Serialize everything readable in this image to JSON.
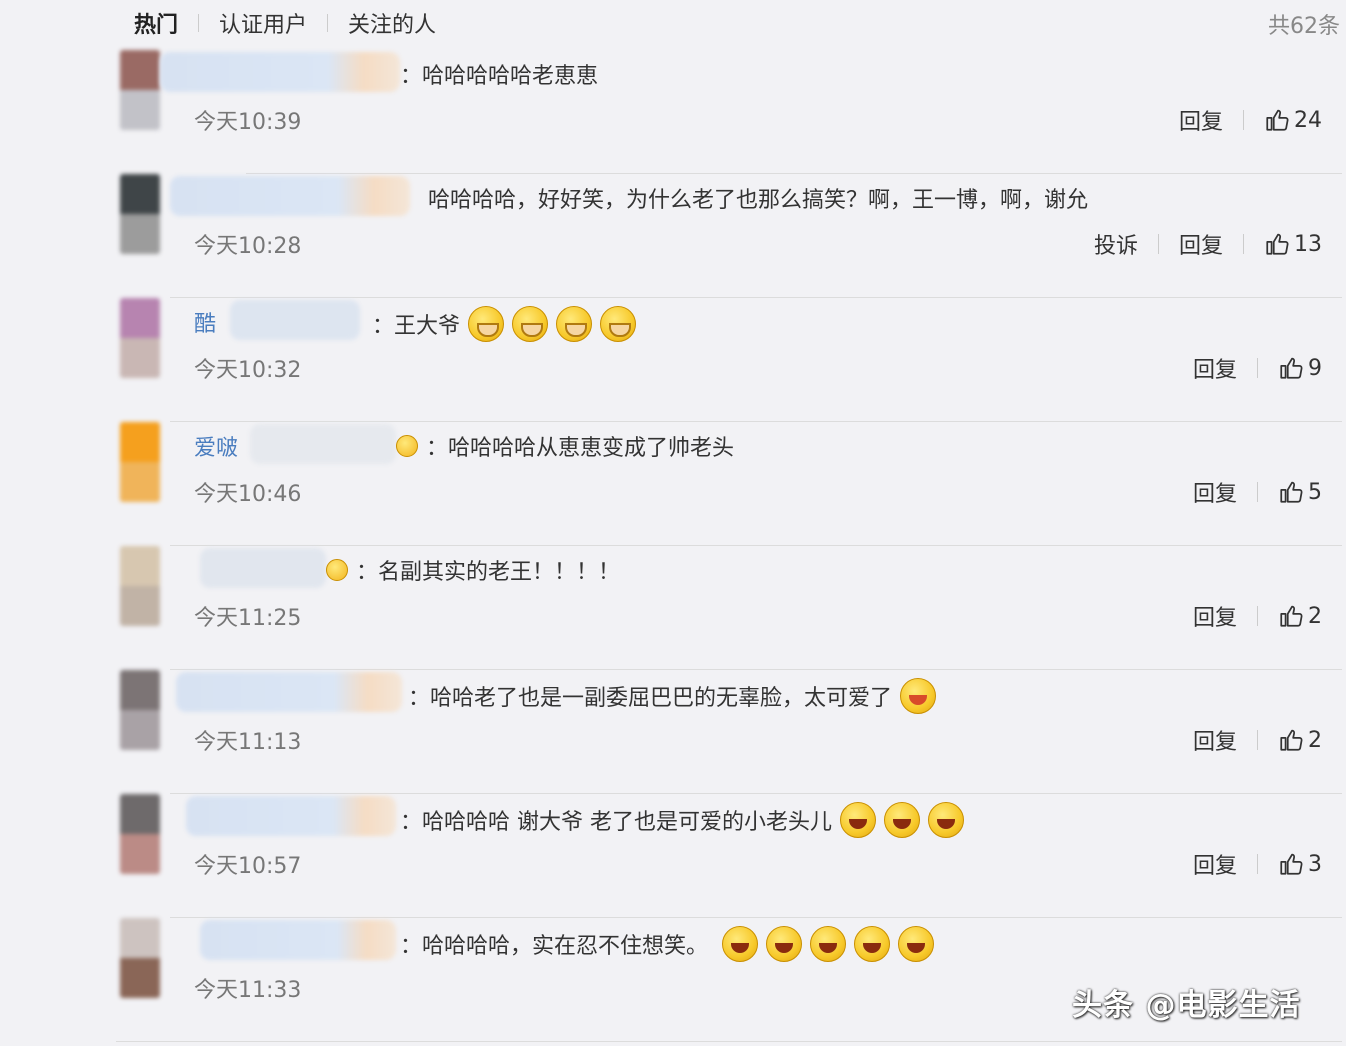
{
  "tabs": [
    "热门",
    "认证用户",
    "关注的人"
  ],
  "total": "共62条",
  "reply_label": "回复",
  "report_label": "投诉",
  "comments": [
    {
      "name": "",
      "content": "：哈哈哈哈哈老恵恵",
      "time": "今天10:39",
      "likes": "24",
      "has_report": false,
      "avatar_colors": [
        "#9a6a64",
        "#c2c2c8"
      ]
    },
    {
      "name": "",
      "content": "哈哈哈哈，好好笑，为什么老了也那么搞笑？啊，王一博，啊，谢允",
      "time": "今天10:28",
      "likes": "13",
      "has_report": true,
      "avatar_colors": [
        "#3f4548",
        "#9c9c9c"
      ]
    },
    {
      "name": "酷",
      "content": "：王大爷",
      "time": "今天10:32",
      "likes": "9",
      "has_report": false,
      "avatar_colors": [
        "#b784b0",
        "#c9b7b4"
      ]
    },
    {
      "name": "爱啵",
      "content": "：哈哈哈哈从恵恵变成了帅老头",
      "time": "今天10:46",
      "likes": "5",
      "has_report": false,
      "avatar_colors": [
        "#f5a01e",
        "#f0b45a"
      ]
    },
    {
      "name": "",
      "content": "：名副其实的老王！！！！",
      "time": "今天11:25",
      "likes": "2",
      "has_report": false,
      "avatar_colors": [
        "#d7c7b0",
        "#c1b3a6"
      ]
    },
    {
      "name": "",
      "content": "：哈哈老了也是一副委屈巴巴的无辜脸，太可爱了",
      "time": "今天11:13",
      "likes": "2",
      "has_report": false,
      "avatar_colors": [
        "#7c7475",
        "#a9a2a6"
      ]
    },
    {
      "name": "",
      "content": "：哈哈哈哈 谢大爷 老了也是可爱的小老头儿",
      "time": "今天10:57",
      "likes": "3",
      "has_report": false,
      "avatar_colors": [
        "#6e6a6b",
        "#bb8b86"
      ]
    },
    {
      "name": "",
      "content": "：哈哈哈哈，实在忍不住想笑。",
      "time": "今天11:33",
      "likes": "",
      "has_report": false,
      "avatar_colors": [
        "#cdc3c0",
        "#8a6657"
      ]
    }
  ],
  "watermark": "头条 @电影生活"
}
